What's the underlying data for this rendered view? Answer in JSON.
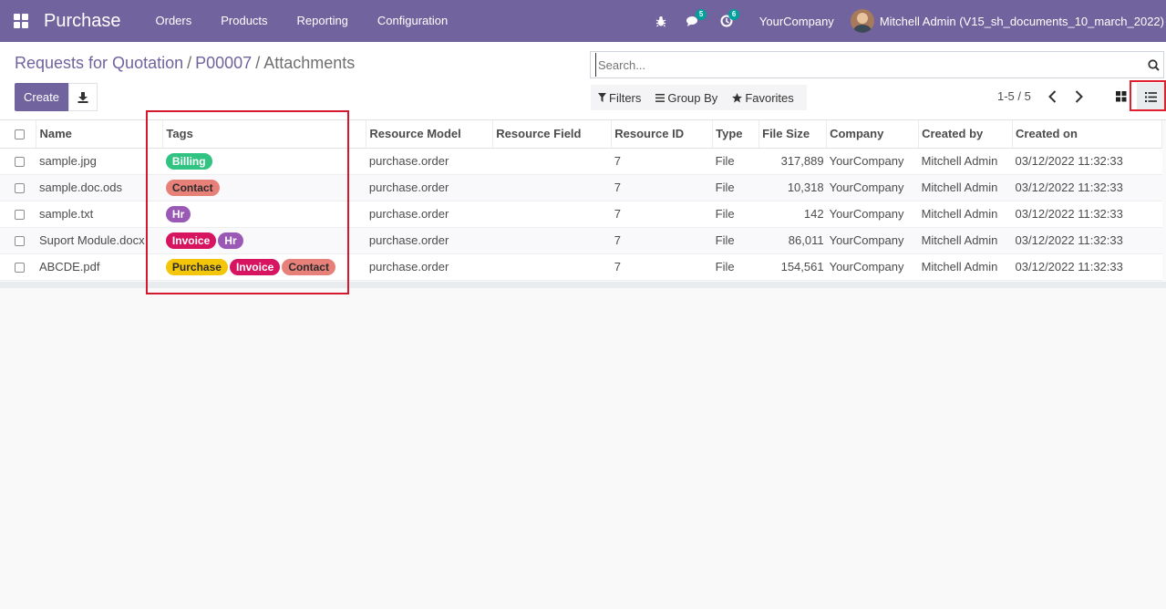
{
  "navbar": {
    "app_name": "Purchase",
    "menu": [
      "Orders",
      "Products",
      "Reporting",
      "Configuration"
    ],
    "messages_badge": "5",
    "activities_badge": "6",
    "company": "YourCompany",
    "user": "Mitchell Admin (V15_sh_documents_10_march_2022)"
  },
  "breadcrumb": {
    "item1": "Requests for Quotation",
    "item2": "P00007",
    "current": "Attachments",
    "separator": "/"
  },
  "toolbar": {
    "create_label": "Create"
  },
  "search": {
    "placeholder": "Search..."
  },
  "filters": {
    "filters_label": "Filters",
    "groupby_label": "Group By",
    "favorites_label": "Favorites"
  },
  "pager": {
    "text": "1-5 / 5"
  },
  "table": {
    "columns": [
      "Name",
      "Tags",
      "Resource Model",
      "Resource Field",
      "Resource ID",
      "Type",
      "File Size",
      "Company",
      "Created by",
      "Created on"
    ],
    "rows": [
      {
        "name": "sample.jpg",
        "tags": [
          "Billing"
        ],
        "model": "purchase.order",
        "field": "",
        "res_id": "7",
        "type": "File",
        "size": "317,889",
        "company": "YourCompany",
        "created_by": "Mitchell Admin",
        "created_on": "03/12/2022 11:32:33"
      },
      {
        "name": "sample.doc.ods",
        "tags": [
          "Contact"
        ],
        "model": "purchase.order",
        "field": "",
        "res_id": "7",
        "type": "File",
        "size": "10,318",
        "company": "YourCompany",
        "created_by": "Mitchell Admin",
        "created_on": "03/12/2022 11:32:33"
      },
      {
        "name": "sample.txt",
        "tags": [
          "Hr"
        ],
        "model": "purchase.order",
        "field": "",
        "res_id": "7",
        "type": "File",
        "size": "142",
        "company": "YourCompany",
        "created_by": "Mitchell Admin",
        "created_on": "03/12/2022 11:32:33"
      },
      {
        "name": "Suport Module.docx",
        "tags": [
          "Invoice",
          "Hr"
        ],
        "model": "purchase.order",
        "field": "",
        "res_id": "7",
        "type": "File",
        "size": "86,011",
        "company": "YourCompany",
        "created_by": "Mitchell Admin",
        "created_on": "03/12/2022 11:32:33"
      },
      {
        "name": "ABCDE.pdf",
        "tags": [
          "Purchase",
          "Invoice",
          "Contact"
        ],
        "model": "purchase.order",
        "field": "",
        "res_id": "7",
        "type": "File",
        "size": "154,561",
        "company": "YourCompany",
        "created_by": "Mitchell Admin",
        "created_on": "03/12/2022 11:32:33"
      }
    ]
  },
  "tag_colors": {
    "Billing": {
      "bg": "#30c381",
      "fg": "#ffffff"
    },
    "Contact": {
      "bg": "#e8807a",
      "fg": "#2b2b2b"
    },
    "Hr": {
      "bg": "#9b59b6",
      "fg": "#ffffff"
    },
    "Invoice": {
      "bg": "#d6145f",
      "fg": "#ffffff"
    },
    "Purchase": {
      "bg": "#f4c609",
      "fg": "#2b2b2b"
    }
  },
  "colors": {
    "brand": "#71639e",
    "highlight": "#d6182f",
    "badge": "#00a09d"
  }
}
